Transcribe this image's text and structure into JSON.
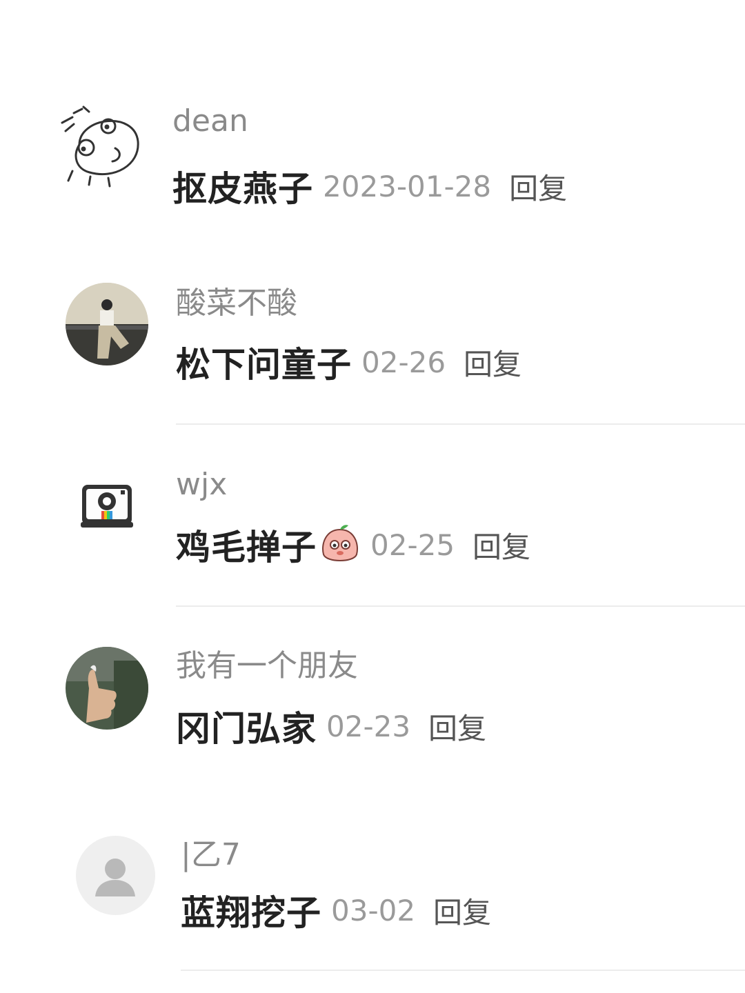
{
  "comments": [
    {
      "username": "dean",
      "text": "抠皮燕子",
      "date": "2023-01-28",
      "reply": "回复",
      "avatar_icon": "doodle-face-icon"
    },
    {
      "username": "酸菜不酸",
      "text": "松下问童子",
      "date": "02-26",
      "reply": "回复",
      "avatar_icon": "photo-avatar-woman"
    },
    {
      "username": "wjx",
      "text": "鸡毛掸子",
      "date": "02-25",
      "reply": "回复",
      "avatar_icon": "camera-icon",
      "emoji": "peach-face-emoji"
    },
    {
      "username": "我有一个朋友",
      "text": "冈门弘家",
      "date": "02-23",
      "reply": "回复",
      "avatar_icon": "thumbs-up-photo-avatar"
    },
    {
      "username": "|乙7",
      "text": "蓝翔挖子",
      "date": "03-02",
      "reply": "回复",
      "avatar_icon": "default-user-icon"
    }
  ],
  "colors": {
    "username": "#8a8a8a",
    "text": "#222222",
    "date": "#9a9a9a",
    "reply": "#555555",
    "divider": "#ececec"
  }
}
